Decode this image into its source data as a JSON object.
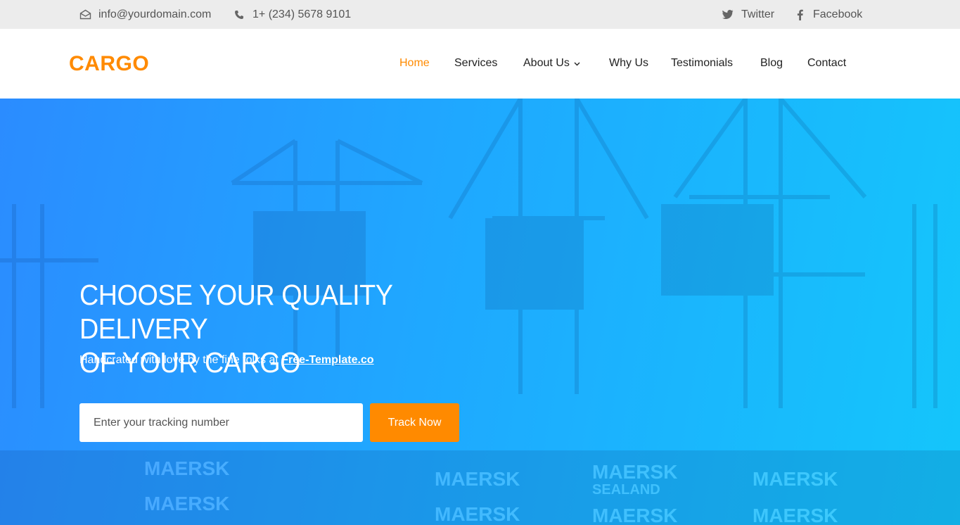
{
  "topbar": {
    "email": "info@yourdomain.com",
    "email_icon": "envelope-icon",
    "phone": "1+ (234) 5678 9101",
    "phone_icon": "phone-icon",
    "twitter": "Twitter",
    "twitter_icon": "twitter-icon",
    "facebook": "Facebook",
    "facebook_icon": "facebook-icon"
  },
  "brand": {
    "logo": "CARGO",
    "color": "#ff8a00"
  },
  "nav": {
    "items": [
      {
        "label": "Home",
        "active": true
      },
      {
        "label": "Services"
      },
      {
        "label": "About Us",
        "dropdown": true,
        "icon": "chevron-down-icon"
      },
      {
        "label": "Why Us"
      },
      {
        "label": "Testimonials"
      },
      {
        "label": "Blog"
      },
      {
        "label": "Contact"
      }
    ]
  },
  "hero": {
    "title_line1": "CHOOSE YOUR QUALITY DELIVERY",
    "title_line2": "OF YOUR CARGO",
    "subtitle_prefix": "Handcrated with love by the fine folks at",
    "subtitle_link": "Free-Template.co",
    "tracking_placeholder": "Enter your tracking number",
    "track_button": "Track Now",
    "gradient_colors": [
      "#2b8cff",
      "#14c6fb"
    ],
    "button_color": "#ff8a00",
    "watermark_brand": "MAERSK",
    "watermark_brand_2": "SEALAND"
  }
}
